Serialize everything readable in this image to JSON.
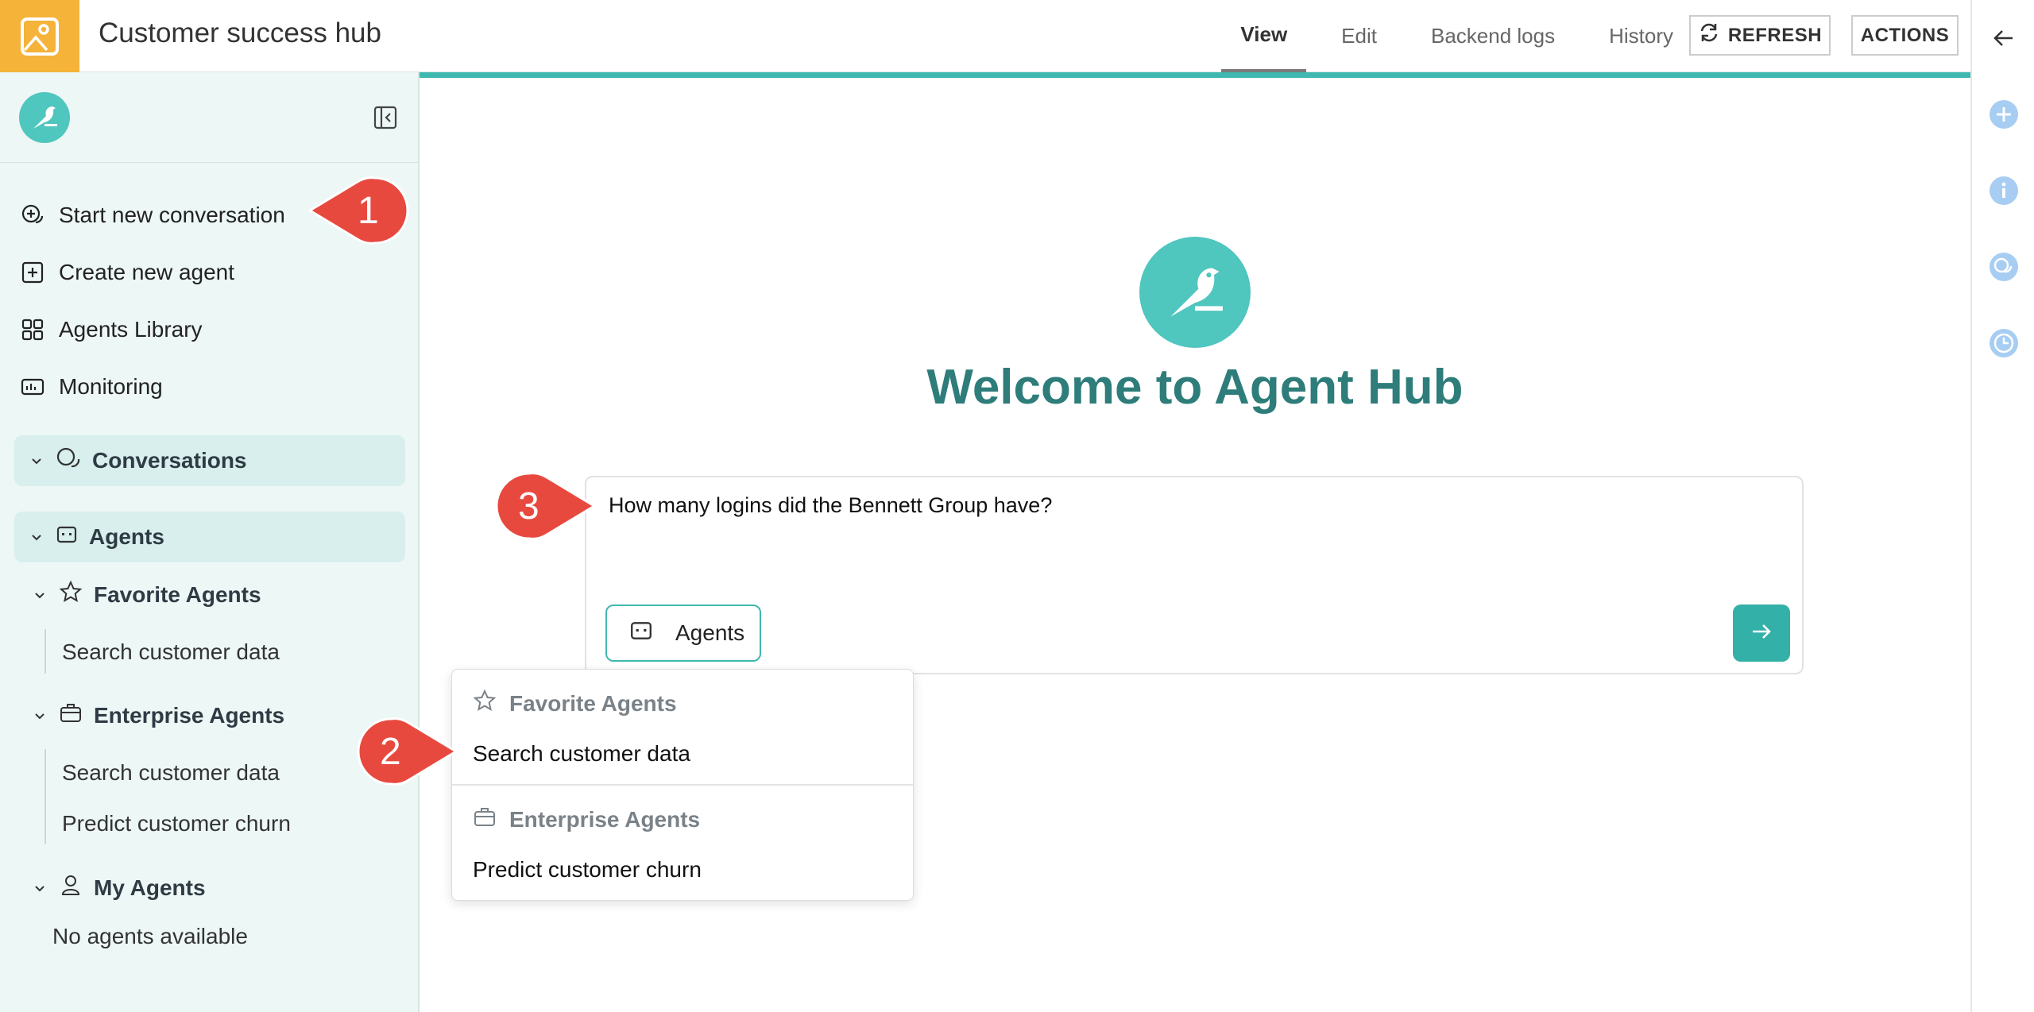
{
  "app": {
    "title": "Customer success hub",
    "accent_color": "#f5b33a",
    "brand_color": "#3fb8b0"
  },
  "topbar": {
    "tabs": [
      {
        "label": "View",
        "active": true
      },
      {
        "label": "Edit",
        "active": false
      },
      {
        "label": "Backend logs",
        "active": false
      },
      {
        "label": "History",
        "active": false
      }
    ],
    "refresh_label": "REFRESH",
    "actions_label": "ACTIONS"
  },
  "sidebar": {
    "nav": [
      {
        "label": "Start new conversation",
        "icon": "chat-plus-icon"
      },
      {
        "label": "Create new agent",
        "icon": "plus-square-icon"
      },
      {
        "label": "Agents Library",
        "icon": "grid-icon"
      },
      {
        "label": "Monitoring",
        "icon": "monitor-icon"
      }
    ],
    "conversations_label": "Conversations",
    "agents_label": "Agents",
    "favorite_label": "Favorite Agents",
    "favorite_items": [
      "Search customer data"
    ],
    "enterprise_label": "Enterprise Agents",
    "enterprise_items": [
      "Search customer data",
      "Predict customer churn"
    ],
    "my_label": "My Agents",
    "my_empty": "No agents available"
  },
  "main": {
    "welcome": "Welcome to Agent Hub",
    "chat_input_value": "How many logins did the Bennett Group have?",
    "agents_button": "Agents"
  },
  "dropdown": {
    "favorite_label": "Favorite Agents",
    "favorite_items": [
      "Search customer data"
    ],
    "enterprise_label": "Enterprise Agents",
    "enterprise_items": [
      "Predict customer churn"
    ]
  },
  "callouts": [
    "1",
    "2",
    "3"
  ]
}
